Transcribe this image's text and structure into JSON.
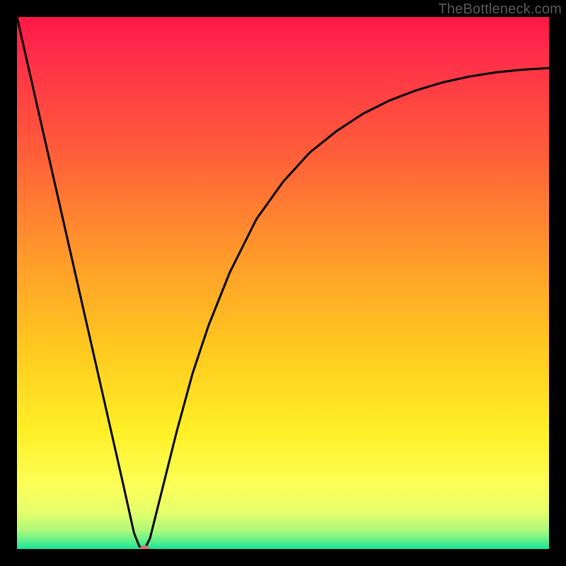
{
  "attribution": "TheBottleneck.com",
  "chart_data": {
    "type": "line",
    "title": "",
    "xlabel": "",
    "ylabel": "",
    "xlim": [
      0,
      100
    ],
    "ylim": [
      0,
      100
    ],
    "grid": false,
    "series": [
      {
        "name": "bottleneck-curve",
        "x": [
          0,
          5,
          10,
          15,
          20,
          22,
          23,
          24,
          25,
          26,
          28,
          30,
          33,
          36,
          40,
          45,
          50,
          55,
          60,
          65,
          70,
          75,
          80,
          85,
          90,
          95,
          100
        ],
        "values": [
          100,
          78,
          56,
          34,
          12,
          3,
          0.5,
          0,
          2,
          6,
          14,
          22,
          33,
          42,
          52,
          62,
          69,
          74.5,
          78.5,
          81.8,
          84.3,
          86.2,
          87.7,
          88.8,
          89.6,
          90.1,
          90.4
        ]
      }
    ],
    "marker": {
      "name": "optimal-point",
      "x": 24,
      "y": 0,
      "color": "#c97a68",
      "radius": 7
    },
    "background_gradient": {
      "stops": [
        {
          "offset": 0.0,
          "color": "#ff1744"
        },
        {
          "offset": 0.06,
          "color": "#ff2a4a"
        },
        {
          "offset": 0.25,
          "color": "#ff5c3a"
        },
        {
          "offset": 0.45,
          "color": "#ff9a2a"
        },
        {
          "offset": 0.62,
          "color": "#ffc81f"
        },
        {
          "offset": 0.78,
          "color": "#fff027"
        },
        {
          "offset": 0.88,
          "color": "#fcff58"
        },
        {
          "offset": 0.93,
          "color": "#e6ff6a"
        },
        {
          "offset": 0.965,
          "color": "#aef97a"
        },
        {
          "offset": 0.985,
          "color": "#5bf08c"
        },
        {
          "offset": 1.0,
          "color": "#17e39b"
        }
      ]
    }
  }
}
